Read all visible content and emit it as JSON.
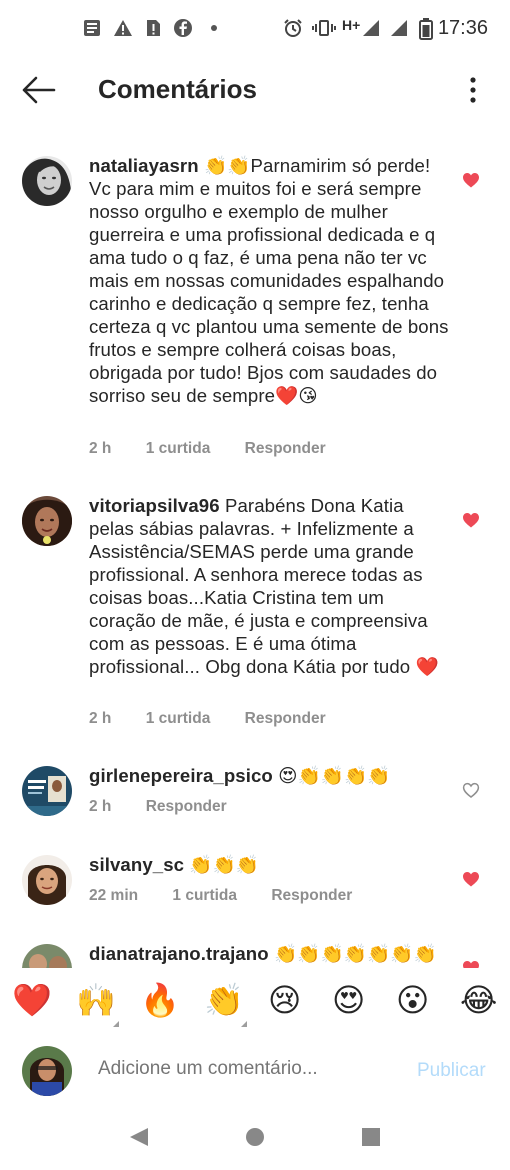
{
  "status_bar": {
    "time": "17:36",
    "network": "H+"
  },
  "header": {
    "title": "Comentários"
  },
  "comments": [
    {
      "username": "nataliayasrn",
      "text": "👏👏Parnamirim só perde! Vc para mim e muitos foi e será sempre nosso orgulho e exemplo de mulher guerreira e uma profissional dedicada e q ama tudo o q faz, é uma pena não ter vc mais em nossas comunidades espalhando carinho e dedicação q sempre fez, tenha certeza q vc plantou uma semente de bons frutos e sempre colherá coisas boas, obrigada por tudo! Bjos com saudades do sorriso seu de sempre❤️😘",
      "time": "2 h",
      "likes": "1 curtida",
      "reply": "Responder",
      "liked": true
    },
    {
      "username": "vitoriapsilva96",
      "text": "Parabéns Dona Katia pelas sábias palavras. + Infelizmente a Assistência/SEMAS perde  uma grande profissional.  A senhora merece todas as coisas boas...Katia Cristina tem um coração de mãe, é justa e compreensiva com as pessoas. E é uma ótima profissional... Obg dona Kátia por tudo ❤️",
      "time": "2 h",
      "likes": "1 curtida",
      "reply": "Responder",
      "liked": true
    },
    {
      "username": "girlenepereira_psico",
      "text": "😍👏👏👏👏",
      "time": "2 h",
      "likes": "",
      "reply": "Responder",
      "liked": false
    },
    {
      "username": "silvany_sc",
      "text": "👏👏👏",
      "time": "22 min",
      "likes": "1 curtida",
      "reply": "Responder",
      "liked": true
    },
    {
      "username": "dianatrajano.trajano",
      "text": "👏👏👏👏👏👏👏",
      "time": "",
      "likes": "",
      "reply": "",
      "liked": true
    }
  ],
  "emoji_bar": [
    "❤️",
    "🙌",
    "🔥",
    "👏",
    "😢",
    "😍",
    "😮",
    "😂"
  ],
  "composer": {
    "placeholder": "Adicione um comentário...",
    "publish_label": "Publicar"
  },
  "colors": {
    "liked_heart": "#ed4956",
    "unliked_heart": "#8e8e8e",
    "publish_disabled": "#b3dbfa",
    "meta_text": "#8e8e8e"
  }
}
